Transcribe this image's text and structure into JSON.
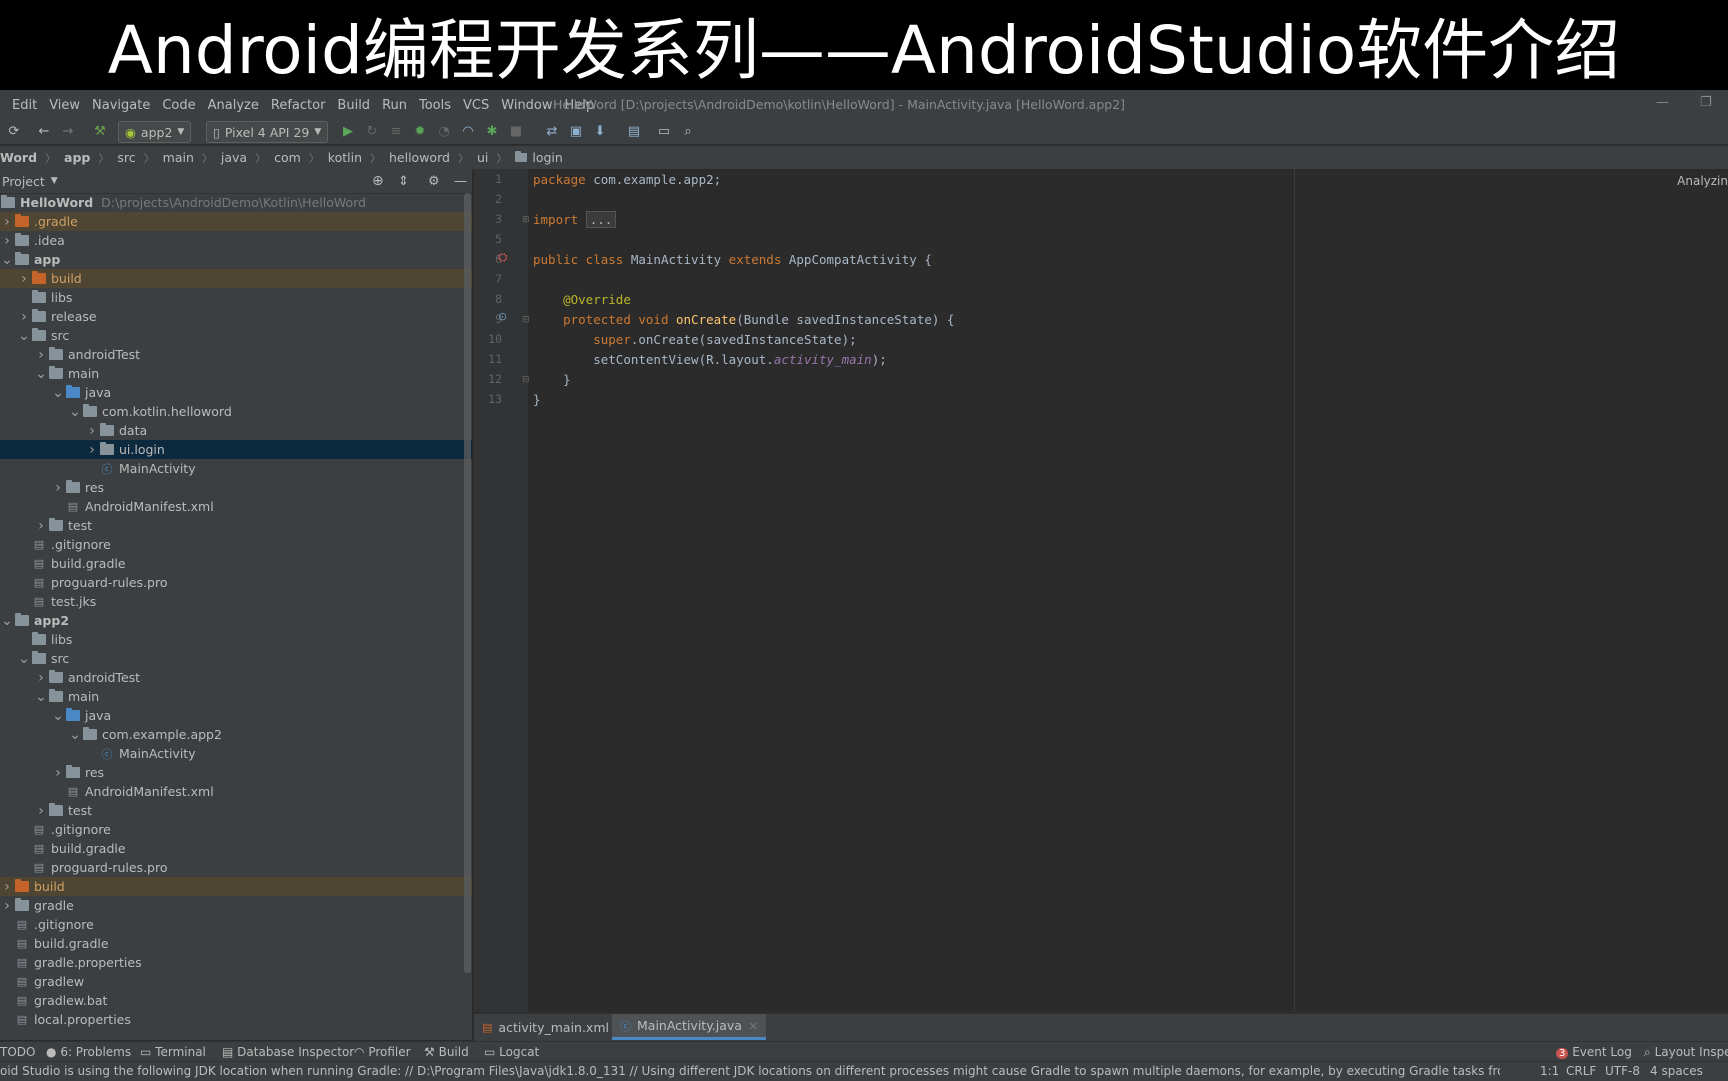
{
  "banner": {
    "title": "Android编程开发系列——AndroidStudio软件介绍"
  },
  "menu": {
    "items": [
      "Edit",
      "View",
      "Navigate",
      "Code",
      "Analyze",
      "Refactor",
      "Build",
      "Run",
      "Tools",
      "VCS",
      "Window",
      "Help"
    ],
    "window_title": "HelloWord [D:\\projects\\AndroidDemo\\kotlin\\HelloWord] - MainActivity.java [HelloWord.app2]"
  },
  "toolbar": {
    "module_config": "app2",
    "device": "Pixel 4 API 29"
  },
  "breadcrumb": [
    "Word",
    "app",
    "src",
    "main",
    "java",
    "com",
    "kotlin",
    "helloword",
    "ui",
    "login"
  ],
  "project_panel": {
    "view_mode": "Project",
    "root_name": "HelloWord",
    "root_path": "D:\\projects\\AndroidDemo\\Kotlin\\HelloWord",
    "items": [
      {
        "label": ".gradle"
      },
      {
        "label": ".idea"
      },
      {
        "label": "app"
      },
      {
        "label": "build"
      },
      {
        "label": "libs"
      },
      {
        "label": "release"
      },
      {
        "label": "src"
      },
      {
        "label": "androidTest"
      },
      {
        "label": "main"
      },
      {
        "label": "java"
      },
      {
        "label": "com.kotlin.helloword"
      },
      {
        "label": "data"
      },
      {
        "label": "ui.login"
      },
      {
        "label": "MainActivity"
      },
      {
        "label": "res"
      },
      {
        "label": "AndroidManifest.xml"
      },
      {
        "label": "test"
      },
      {
        "label": ".gitignore"
      },
      {
        "label": "build.gradle"
      },
      {
        "label": "proguard-rules.pro"
      },
      {
        "label": "test.jks"
      },
      {
        "label": "app2"
      },
      {
        "label": "libs"
      },
      {
        "label": "src"
      },
      {
        "label": "androidTest"
      },
      {
        "label": "main"
      },
      {
        "label": "java"
      },
      {
        "label": "com.example.app2"
      },
      {
        "label": "MainActivity"
      },
      {
        "label": "res"
      },
      {
        "label": "AndroidManifest.xml"
      },
      {
        "label": "test"
      },
      {
        "label": ".gitignore"
      },
      {
        "label": "build.gradle"
      },
      {
        "label": "proguard-rules.pro"
      },
      {
        "label": "build"
      },
      {
        "label": "gradle"
      },
      {
        "label": ".gitignore"
      },
      {
        "label": "build.gradle"
      },
      {
        "label": "gradle.properties"
      },
      {
        "label": "gradlew"
      },
      {
        "label": "gradlew.bat"
      },
      {
        "label": "local.properties"
      }
    ]
  },
  "editor": {
    "line_numbers": [
      "1",
      "2",
      "3",
      "5",
      "6",
      "7",
      "8",
      "9",
      "10",
      "11",
      "12",
      "13"
    ],
    "code": {
      "l1_kw": "package",
      "l1_rest": " com.example.app2;",
      "l3_kw": "import",
      "l3_fold": "...",
      "l6_kw1": "public class",
      "l6_name": " MainActivity ",
      "l6_kw2": "extends",
      "l6_rest": " AppCompatActivity {",
      "l8_ann": "@Override",
      "l9_kw": "protected void",
      "l9_fn": "onCreate",
      "l9_rest": "(Bundle savedInstanceState) {",
      "l10_kw": "super",
      "l10_rest": ".onCreate(savedInstanceState);",
      "l11_a": "setContentView(R.layout.",
      "l11_it": "activity_main",
      "l11_b": ");",
      "l12": "}",
      "l13": "}"
    },
    "status_label": "Analyzin"
  },
  "editor_tabs": [
    {
      "label": "activity_main.xml",
      "active": false
    },
    {
      "label": "MainActivity.java",
      "active": true
    }
  ],
  "tool_windows": {
    "todo": "TODO",
    "problems": "6: Problems",
    "terminal": "Terminal",
    "database": "Database Inspector",
    "profiler": "Profiler",
    "build": "Build",
    "logcat": "Logcat",
    "event_log_count": "3",
    "event_log": "Event Log",
    "layout_inspector": "Layout Inspec"
  },
  "status_bar": {
    "message": "oid Studio is using the following JDK location when running Gradle: // D:\\Program Files\\Java\\jdk1.8.0_131 // Using different JDK locations on different processes might cause Gradle to spawn multiple daemons, for example, by executing Gradle tasks from... (moments ago)",
    "position": "1:1",
    "line_sep": "CRLF",
    "encoding": "UTF-8",
    "indent": "4 spaces"
  },
  "colors": {
    "accent_blue": "#4a88c7",
    "keyword": "#cc7832",
    "annotation": "#bbb529",
    "method": "#ffc66d",
    "field": "#9876aa",
    "folder_orange": "#c4632a"
  }
}
